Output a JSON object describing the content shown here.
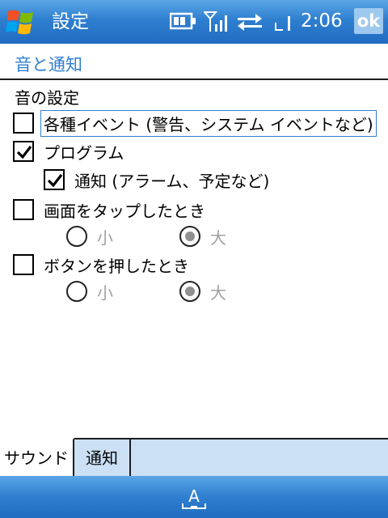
{
  "titlebar": {
    "title": "設定",
    "clock": "2:06",
    "ok_label": "ok"
  },
  "header": {
    "title": "音と通知"
  },
  "section": {
    "label": "音の設定"
  },
  "options": [
    {
      "label": "各種イベント (警告、システム イベントなど)",
      "checked": false
    },
    {
      "label": "プログラム",
      "checked": true
    },
    {
      "label": "通知 (アラーム、予定など)",
      "checked": true
    },
    {
      "label": "画面をタップしたとき",
      "checked": false
    },
    {
      "label": "ボタンを押したとき",
      "checked": false
    }
  ],
  "tap_volume": {
    "small": "小",
    "large": "大",
    "selected": "large"
  },
  "button_volume": {
    "small": "小",
    "large": "大",
    "selected": "large"
  },
  "tabs": [
    {
      "label": "サウンド",
      "active": true
    },
    {
      "label": "通知",
      "active": false
    }
  ],
  "bottombar": {
    "input_icon_letter": "A"
  },
  "colors": {
    "accent": "#2f7fd0",
    "tab_bg": "#cbe0f5",
    "disabled_text": "#a0a0a0"
  },
  "icons": [
    "windows-start-icon",
    "battery-icon",
    "signal-icon",
    "sync-arrows-icon",
    "keyboard-input-icon"
  ]
}
